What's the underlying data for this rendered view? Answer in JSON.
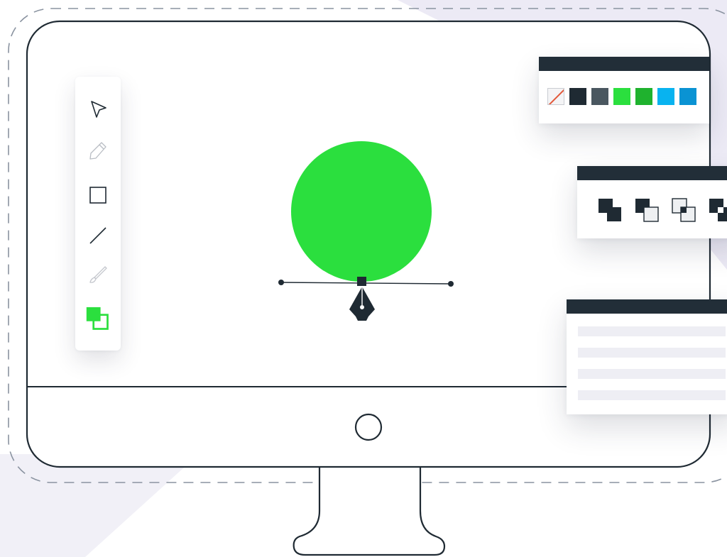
{
  "illustration": {
    "kind": "vector-editor-on-desktop-monitor",
    "colors": {
      "outline": "#1f2a33",
      "dashed_frame": "#8a93a0",
      "accent_green": "#2bdf3e",
      "panel_header": "#222e38",
      "backdrop": "#eceaf5",
      "list_row": "#eeeef4"
    },
    "canvas": {
      "shape": "circle",
      "fill": "#2bdf3e",
      "pen_tool_icon": "pen-nib-icon",
      "anchor_icon": "anchor-point-icon"
    },
    "monitor": {
      "home_button_icon": "home-button-icon"
    }
  },
  "tool_palette": {
    "tools": [
      {
        "icon": "pointer-arrow-icon",
        "active": true
      },
      {
        "icon": "pen-icon",
        "active": false
      },
      {
        "icon": "rectangle-icon",
        "active": true
      },
      {
        "icon": "line-icon",
        "active": true
      },
      {
        "icon": "brush-icon",
        "active": false
      },
      {
        "icon": "fill-stroke-icon",
        "active": true
      }
    ],
    "fill_color": "#2bdf3e",
    "stroke_color": "#2bdf3e"
  },
  "color_panel": {
    "swatches": [
      {
        "name": "none",
        "color": "none"
      },
      {
        "name": "black",
        "color": "#1f2a33"
      },
      {
        "name": "slate",
        "color": "#4a5760"
      },
      {
        "name": "green",
        "color": "#2bdf3e"
      },
      {
        "name": "dark-green",
        "color": "#1fb22e"
      },
      {
        "name": "sky-blue",
        "color": "#08b3f0"
      },
      {
        "name": "blue",
        "color": "#0a93d3"
      }
    ]
  },
  "layer_panel": {
    "buttons": [
      {
        "icon": "merge-shapes-icon"
      },
      {
        "icon": "bring-forward-icon"
      },
      {
        "icon": "send-backward-icon"
      },
      {
        "icon": "intersect-shapes-icon"
      }
    ]
  },
  "list_panel": {
    "row_count": 4
  }
}
